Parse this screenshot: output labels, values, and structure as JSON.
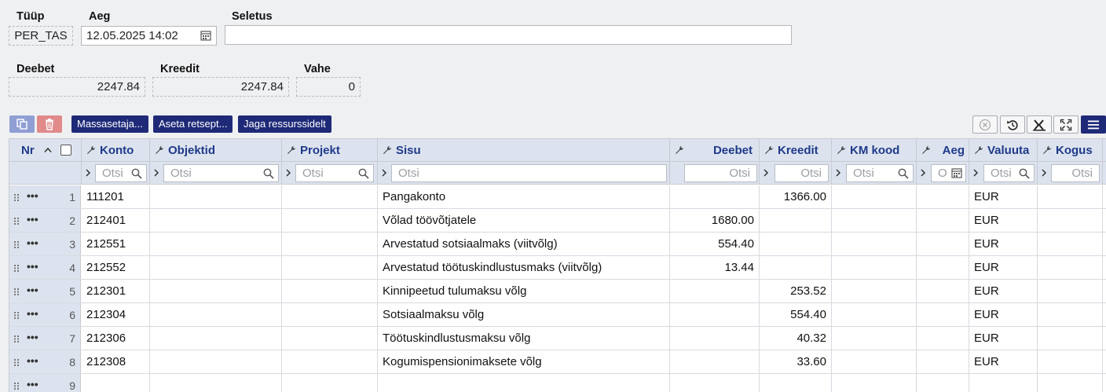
{
  "header": {
    "type_label": "Tüüp",
    "type_value": "PER_TAS",
    "time_label": "Aeg",
    "time_value": "12.05.2025 14:02",
    "desc_label": "Seletus",
    "desc_value": "",
    "debit_label": "Deebet",
    "debit_value": "2247.84",
    "credit_label": "Kreedit",
    "credit_value": "2247.84",
    "diff_label": "Vahe",
    "diff_value": "0"
  },
  "toolbar": {
    "copy_icon": "copy-icon",
    "delete_icon": "trash-icon",
    "mass_label": "Massasetaja...",
    "recipe_label": "Aseta retsept...",
    "share_label": "Jaga ressurssidelt",
    "right_icons": [
      "clear-icon",
      "undo-icon",
      "excel-icon",
      "fullscreen-icon",
      "menu-icon"
    ]
  },
  "grid": {
    "columns": {
      "nr": "Nr",
      "konto": "Konto",
      "objektid": "Objektid",
      "projekt": "Projekt",
      "sisu": "Sisu",
      "deebet": "Deebet",
      "kreedit": "Kreedit",
      "km_kood": "KM kood",
      "aeg": "Aeg",
      "valuuta": "Valuuta",
      "kogus": "Kogus"
    },
    "filter_placeholder": "Otsi",
    "filter_placeholder_short": "O",
    "row_menu": "•••",
    "rows": [
      {
        "nr": "1",
        "konto": "111201",
        "objektid": "",
        "projekt": "",
        "sisu": "Pangakonto",
        "deebet": "",
        "kreedit": "1366.00",
        "km_kood": "",
        "aeg": "",
        "valuuta": "EUR",
        "kogus": ""
      },
      {
        "nr": "2",
        "konto": "212401",
        "objektid": "",
        "projekt": "",
        "sisu": "Võlad töövõtjatele",
        "deebet": "1680.00",
        "kreedit": "",
        "km_kood": "",
        "aeg": "",
        "valuuta": "EUR",
        "kogus": ""
      },
      {
        "nr": "3",
        "konto": "212551",
        "objektid": "",
        "projekt": "",
        "sisu": "Arvestatud sotsiaalmaks (viitvõlg)",
        "deebet": "554.40",
        "kreedit": "",
        "km_kood": "",
        "aeg": "",
        "valuuta": "EUR",
        "kogus": ""
      },
      {
        "nr": "4",
        "konto": "212552",
        "objektid": "",
        "projekt": "",
        "sisu": "Arvestatud töötuskindlustusmaks (viitvõlg)",
        "deebet": "13.44",
        "kreedit": "",
        "km_kood": "",
        "aeg": "",
        "valuuta": "EUR",
        "kogus": ""
      },
      {
        "nr": "5",
        "konto": "212301",
        "objektid": "",
        "projekt": "",
        "sisu": "Kinnipeetud tulumaksu võlg",
        "deebet": "",
        "kreedit": "253.52",
        "km_kood": "",
        "aeg": "",
        "valuuta": "EUR",
        "kogus": ""
      },
      {
        "nr": "6",
        "konto": "212304",
        "objektid": "",
        "projekt": "",
        "sisu": "Sotsiaalmaksu võlg",
        "deebet": "",
        "kreedit": "554.40",
        "km_kood": "",
        "aeg": "",
        "valuuta": "EUR",
        "kogus": ""
      },
      {
        "nr": "7",
        "konto": "212306",
        "objektid": "",
        "projekt": "",
        "sisu": "Töötuskindlustusmaksu võlg",
        "deebet": "",
        "kreedit": "40.32",
        "km_kood": "",
        "aeg": "",
        "valuuta": "EUR",
        "kogus": ""
      },
      {
        "nr": "8",
        "konto": "212308",
        "objektid": "",
        "projekt": "",
        "sisu": "Kogumispensionimaksete võlg",
        "deebet": "",
        "kreedit": "33.60",
        "km_kood": "",
        "aeg": "",
        "valuuta": "EUR",
        "kogus": ""
      },
      {
        "nr": "9",
        "konto": "",
        "objektid": "",
        "projekt": "",
        "sisu": "",
        "deebet": "",
        "kreedit": "",
        "km_kood": "",
        "aeg": "",
        "valuuta": "",
        "kogus": ""
      }
    ]
  },
  "colors": {
    "accent": "#1e2a78",
    "header_text": "#1e3a8a",
    "header_bg": "#dde3ee",
    "delete": "#e08a8a",
    "copy": "#8f9fd4"
  }
}
